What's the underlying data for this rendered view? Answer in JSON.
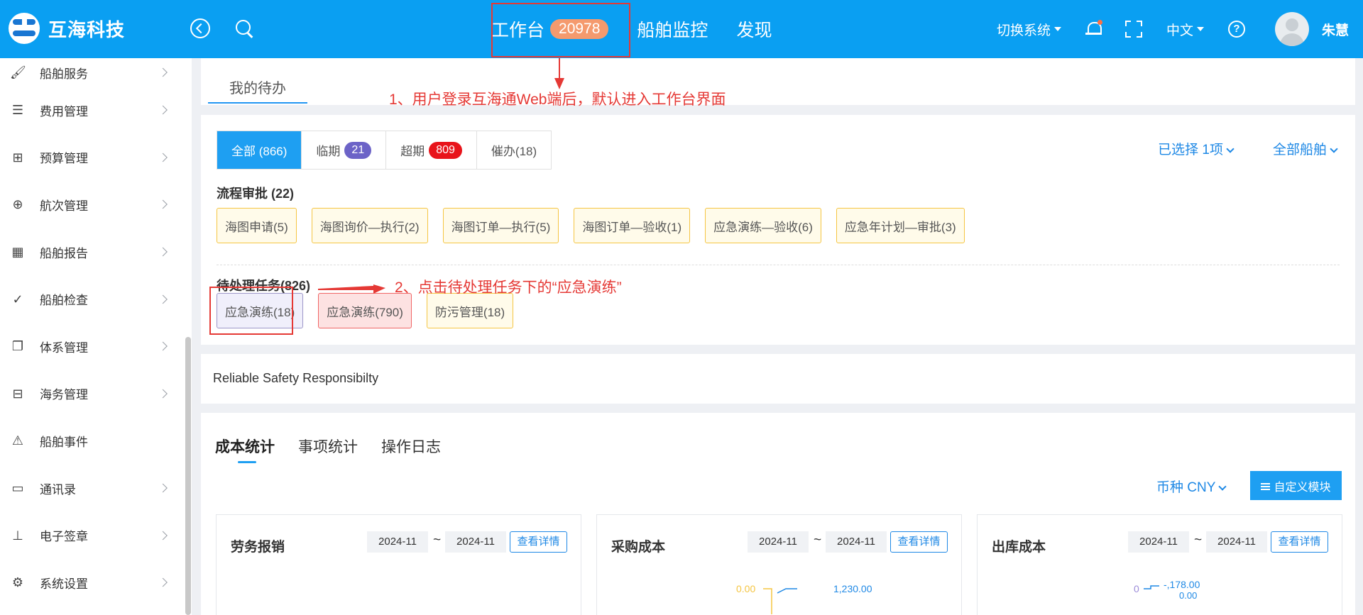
{
  "header": {
    "brand": "互海科技",
    "nav": [
      {
        "label": "工作台",
        "badge": "20978"
      },
      {
        "label": "船舶监控"
      },
      {
        "label": "发现"
      }
    ],
    "switch_system": "切换系统",
    "language": "中文",
    "help": "?",
    "username": "朱慧"
  },
  "sidebar": {
    "items": [
      {
        "label": "船舶服务",
        "icon": "paint-roller-icon"
      },
      {
        "label": "费用管理",
        "icon": "database-icon"
      },
      {
        "label": "预算管理",
        "icon": "calculator-icon"
      },
      {
        "label": "航次管理",
        "icon": "globe-icon"
      },
      {
        "label": "船舶报告",
        "icon": "calendar-icon"
      },
      {
        "label": "船舶检查",
        "icon": "check-circle-icon"
      },
      {
        "label": "体系管理",
        "icon": "documents-icon"
      },
      {
        "label": "海务管理",
        "icon": "signpost-icon"
      },
      {
        "label": "船舶事件",
        "icon": "warning-icon"
      },
      {
        "label": "通讯录",
        "icon": "drive-icon"
      },
      {
        "label": "电子签章",
        "icon": "stamp-icon"
      },
      {
        "label": "系统设置",
        "icon": "gear-icon"
      }
    ]
  },
  "todo_tab": "我的待办",
  "filters": {
    "all": "全部 (866)",
    "near_label": "临期",
    "near_count": "21",
    "overdue_label": "超期",
    "overdue_count": "809",
    "urge": "催办(18)",
    "selected": "已选择 1项",
    "ships": "全部船舶"
  },
  "approval": {
    "title": "流程审批 (22)",
    "chips": [
      "海图申请(5)",
      "海图询价—执行(2)",
      "海图订单—执行(5)",
      "海图订单—验收(1)",
      "应急演练—验收(6)",
      "应急年计划—审批(3)"
    ]
  },
  "pending": {
    "title": "待处理任务(826)",
    "chips": [
      "应急演练(18)",
      "应急演练(790)",
      "防污管理(18)"
    ]
  },
  "annotations": {
    "step1": "1、用户登录互海通Web端后，默认进入工作台界面",
    "step2": "2、点击待处理任务下的“应急演练”"
  },
  "motto": "Reliable Safety Responsibilty",
  "stats": {
    "tabs": [
      "成本统计",
      "事项统计",
      "操作日志"
    ],
    "currency": "币种 CNY",
    "custom_button": "自定义模块",
    "cards": [
      {
        "title": "劳务报销",
        "from": "2024-11",
        "tilde": "~",
        "to": "2024-11",
        "detail": "查看详情",
        "labels": []
      },
      {
        "title": "采购成本",
        "from": "2024-11",
        "tilde": "~",
        "to": "2024-11",
        "detail": "查看详情",
        "labels": [
          "0.00",
          "1,230.00"
        ]
      },
      {
        "title": "出库成本",
        "from": "2024-11",
        "tilde": "~",
        "to": "2024-11",
        "detail": "查看详情",
        "labels": [
          "0",
          "-,178.00",
          "0.00"
        ]
      }
    ]
  },
  "colors": {
    "topbar": "#0a9ff2",
    "accent": "#1e9ff2",
    "near_pill": "#6c63c7",
    "overdue_pill": "#e8141b",
    "annotation": "#e53935"
  }
}
